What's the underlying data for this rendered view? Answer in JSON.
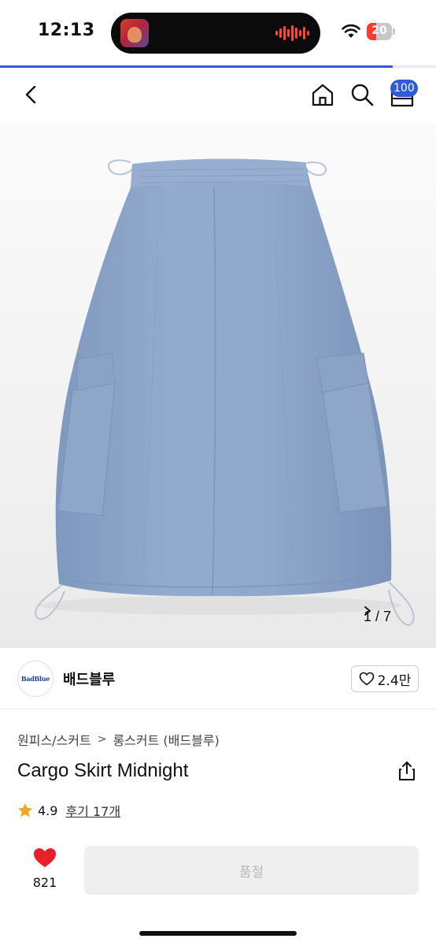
{
  "status_bar": {
    "time": "12:13",
    "battery_level": "20",
    "battery_color": "#ff3b30"
  },
  "page_load_progress": 0.9,
  "nav": {
    "cart_badge": "100",
    "icons": [
      "back-icon",
      "home-icon",
      "search-icon",
      "cart-icon"
    ]
  },
  "product_image": {
    "counter": "1 / 7",
    "counter_icon": "chevron-right-icon",
    "skirt_color": "#8ea6c9"
  },
  "brand": {
    "logo_text": "BadBlue",
    "name": "배드블루",
    "like_count": "2.4만"
  },
  "breadcrumb": [
    "원피스/스커트",
    "롱스커트 (배드블루)"
  ],
  "product": {
    "title": "Cargo Skirt Midnight",
    "rating": "4.9",
    "reviews": "후기 17개"
  },
  "bottom_bar": {
    "wishlist_count": "821",
    "soldout_label": "품절",
    "accent_red": "#e8202a"
  }
}
